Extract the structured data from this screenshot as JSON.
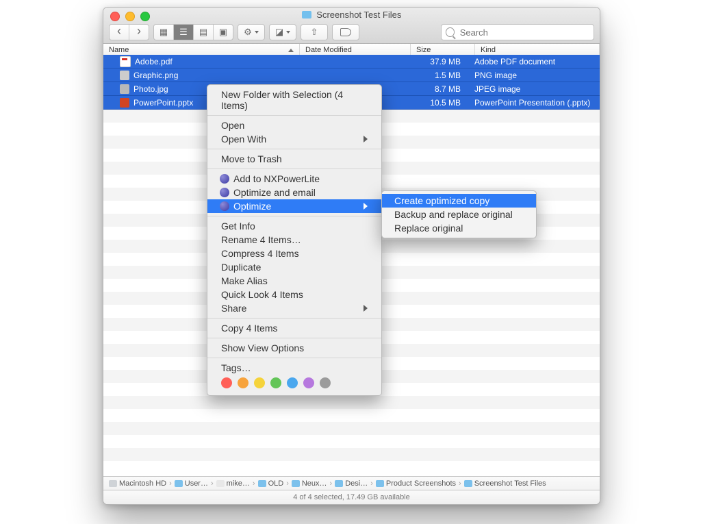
{
  "window": {
    "title": "Screenshot Test Files"
  },
  "search": {
    "placeholder": "Search"
  },
  "columns": {
    "name": "Name",
    "date": "Date Modified",
    "size": "Size",
    "kind": "Kind"
  },
  "files": [
    {
      "name": "Adobe.pdf",
      "size": "37.9 MB",
      "kind": "Adobe PDF document",
      "icon": "ic-pdf"
    },
    {
      "name": "Graphic.png",
      "size": "1.5 MB",
      "kind": "PNG image",
      "icon": "ic-png"
    },
    {
      "name": "Photo.jpg",
      "size": "8.7 MB",
      "kind": "JPEG image",
      "icon": "ic-jpg"
    },
    {
      "name": "PowerPoint.pptx",
      "size": "10.5 MB",
      "kind": "PowerPoint Presentation (.pptx)",
      "icon": "ic-pptx"
    }
  ],
  "context_menu": {
    "new_folder": "New Folder with Selection (4 Items)",
    "open": "Open",
    "open_with": "Open With",
    "trash": "Move to Trash",
    "add_nx": "Add to NXPowerLite",
    "opt_email": "Optimize and email",
    "optimize": "Optimize",
    "get_info": "Get Info",
    "rename": "Rename 4 Items…",
    "compress": "Compress 4 Items",
    "duplicate": "Duplicate",
    "alias": "Make Alias",
    "quicklook": "Quick Look 4 Items",
    "share": "Share",
    "copy": "Copy 4 Items",
    "view_opts": "Show View Options",
    "tags": "Tags…"
  },
  "submenu": {
    "create_copy": "Create optimized copy",
    "backup_replace": "Backup and replace original",
    "replace": "Replace original"
  },
  "tag_colors": [
    "#ff5f57",
    "#f7a33c",
    "#f5d33b",
    "#63c558",
    "#4aa7ee",
    "#b678de",
    "#9b9b9b"
  ],
  "path": [
    "Macintosh HD",
    "User…",
    "mike…",
    "OLD",
    "Neux…",
    "Desi…",
    "Product Screenshots",
    "Screenshot Test Files"
  ],
  "status": "4 of 4 selected, 17.49 GB available"
}
